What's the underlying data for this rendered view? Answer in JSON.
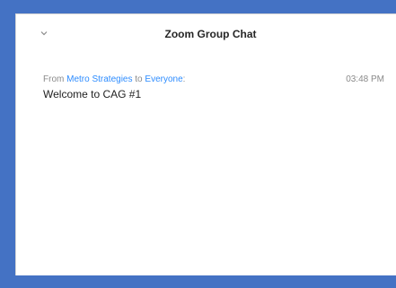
{
  "chat": {
    "title": "Zoom Group Chat",
    "collapse_icon": "chevron-down-icon",
    "messages": [
      {
        "from_prefix": "From",
        "sender": "Metro Strategies",
        "to_word": "to",
        "recipient": "Everyone",
        "recipient_suffix": ":",
        "time": "03:48 PM",
        "text": "Welcome to CAG #1"
      }
    ]
  },
  "colors": {
    "frame_border": "#4472c4",
    "link": "#2d8cff",
    "meta_text": "#8a8a8a",
    "body_text": "#1f1f1f"
  }
}
